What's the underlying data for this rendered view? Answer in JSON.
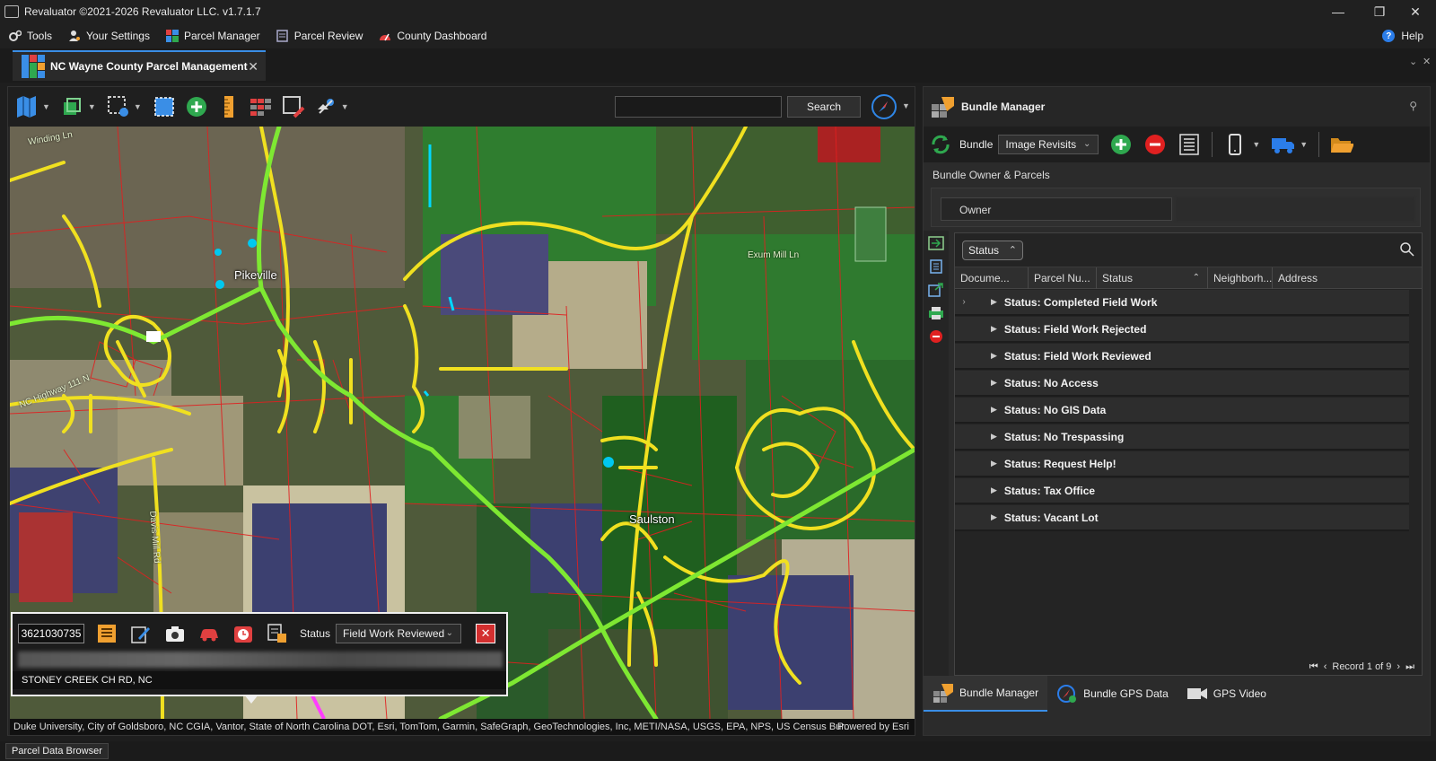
{
  "window": {
    "title": "Revaluator ©2021-2026 Revaluator LLC. v1.7.1.7",
    "controls": [
      "minimize-icon",
      "restore-icon",
      "close-icon"
    ]
  },
  "menu": {
    "items": [
      {
        "label": "Tools",
        "icon": "gears-icon"
      },
      {
        "label": "Your Settings",
        "icon": "user-settings-icon"
      },
      {
        "label": "Parcel Manager",
        "icon": "parcel-manager-icon"
      },
      {
        "label": "Parcel Review",
        "icon": "parcel-review-icon"
      },
      {
        "label": "County Dashboard",
        "icon": "dashboard-icon"
      }
    ],
    "help_label": "Help"
  },
  "tab": {
    "label": "NC Wayne County Parcel Management"
  },
  "map": {
    "search_placeholder": "",
    "search_label": "Search",
    "place_labels": [
      "Pikeville",
      "Saulston"
    ],
    "road_labels": [
      "Exum Mill Ln",
      "NC Highway 111 N",
      "Davis Mill Rd",
      "Winding Ln"
    ],
    "attribution": "Duke University, City of Goldsboro, NC CGIA, Vantor, State of North Carolina DOT, Esri, TomTom, Garmin, SafeGraph, GeoTechnologies, Inc, METI/NASA, USGS, EPA, NPS, US Census Bur...",
    "powered_by": "Powered by Esri"
  },
  "parcel_popup": {
    "parcel_id": "3621030735",
    "status_label": "Status",
    "status_value": "Field Work Reviewed",
    "address": "STONEY CREEK CH RD, NC"
  },
  "bundle_manager": {
    "title": "Bundle Manager",
    "bundle_label": "Bundle",
    "bundle_value": "Image Revisits",
    "owner_section": "Bundle Owner & Parcels",
    "owner_label": "Owner",
    "group_chip": "Status",
    "columns": [
      "Docume...",
      "Parcel Nu...",
      "Status",
      "Neighborh...",
      "Address"
    ],
    "groups": [
      "Status: Completed Field Work",
      "Status: Field Work Rejected",
      "Status: Field Work Reviewed",
      "Status: No Access",
      "Status: No GIS Data",
      "Status: No Trespassing",
      "Status: Request Help!",
      "Status: Tax Office",
      "Status: Vacant Lot"
    ],
    "pager": "Record 1 of 9",
    "footer_tabs": [
      "Bundle Manager",
      "Bundle GPS Data",
      "GPS Video"
    ]
  },
  "statusbar": {
    "tab": "Parcel Data Browser"
  },
  "colors": {
    "accent": "#3a8ee6",
    "green": "#2fa84f",
    "red": "#d32f2f",
    "orange": "#f0a030"
  }
}
